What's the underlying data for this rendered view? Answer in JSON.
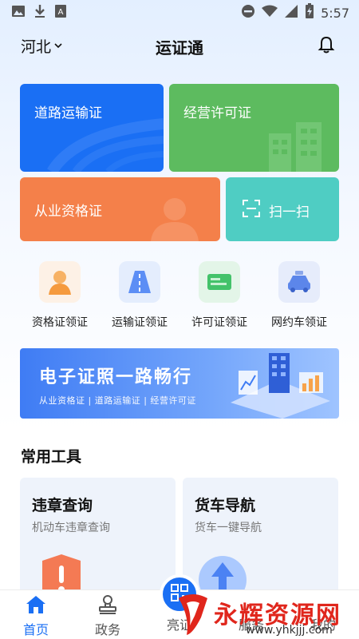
{
  "status_bar": {
    "time": "5:57",
    "left_icons": [
      "image-icon",
      "download-icon",
      "font-icon"
    ],
    "right_icons": [
      "dnd-icon",
      "wifi-icon",
      "signal-icon",
      "battery-icon"
    ]
  },
  "header": {
    "region": "河北",
    "title": "运证通",
    "bell_icon": "bell-icon"
  },
  "cards": {
    "road_transport": "道路运输证",
    "business_permit": "经营许可证",
    "qualification": "从业资格证",
    "scan": "扫一扫"
  },
  "quick_actions": [
    {
      "label": "资格证领证",
      "icon": "person-icon"
    },
    {
      "label": "运输证领证",
      "icon": "road-icon"
    },
    {
      "label": "许可证领证",
      "icon": "card-icon"
    },
    {
      "label": "网约车领证",
      "icon": "car-icon"
    }
  ],
  "banner": {
    "title": "电子证照一路畅行",
    "subtitle": "从业资格证 | 道路运输证 | 经营许可证"
  },
  "section": {
    "title": "常用工具"
  },
  "tools": [
    {
      "title": "违章查询",
      "subtitle": "机动车违章查询",
      "icon": "warning-shield-icon"
    },
    {
      "title": "货车导航",
      "subtitle": "货车一键导航",
      "icon": "navigation-arrow-icon"
    }
  ],
  "tabbar": {
    "home": "首页",
    "government": "政务",
    "certificate": "亮证",
    "tab4": "服务",
    "mine": "我的"
  },
  "watermark": {
    "text": "永辉资源网",
    "url": "www.yhkjjj.com"
  },
  "colors": {
    "primary": "#1a6ff4",
    "green": "#5dbb5f",
    "orange": "#f4804a",
    "teal": "#4fcdc3",
    "watermark_red": "#e0261c"
  }
}
